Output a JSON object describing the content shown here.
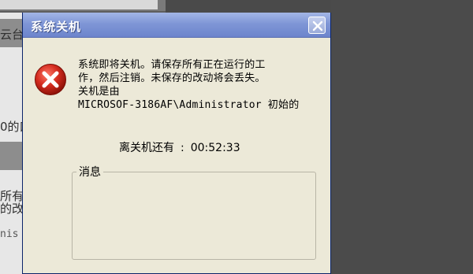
{
  "dialog": {
    "title": "系统关机",
    "message_lines": [
      "系统即将关机。请保存所有正在运行的工",
      "作，然后注销。未保存的改动将会丢失。",
      "关机是由",
      "MICROSOF-3186AF\\Administrator 初始的"
    ],
    "countdown_label": "离关机还有",
    "countdown_separator": ":",
    "countdown_value": "00:52:33",
    "message_group_label": "消息",
    "message_group_content": ""
  },
  "background": {
    "partial_texts": [
      "云台",
      "0的口",
      "所有",
      "的改",
      "nis"
    ]
  },
  "colors": {
    "titlebar_start": "#a3b6e6",
    "titlebar_end": "#6c84cc",
    "dialog_bg": "#ece9d8",
    "error_red": "#d32b1e"
  },
  "icons": {
    "error": "error-icon",
    "close": "close-icon"
  }
}
